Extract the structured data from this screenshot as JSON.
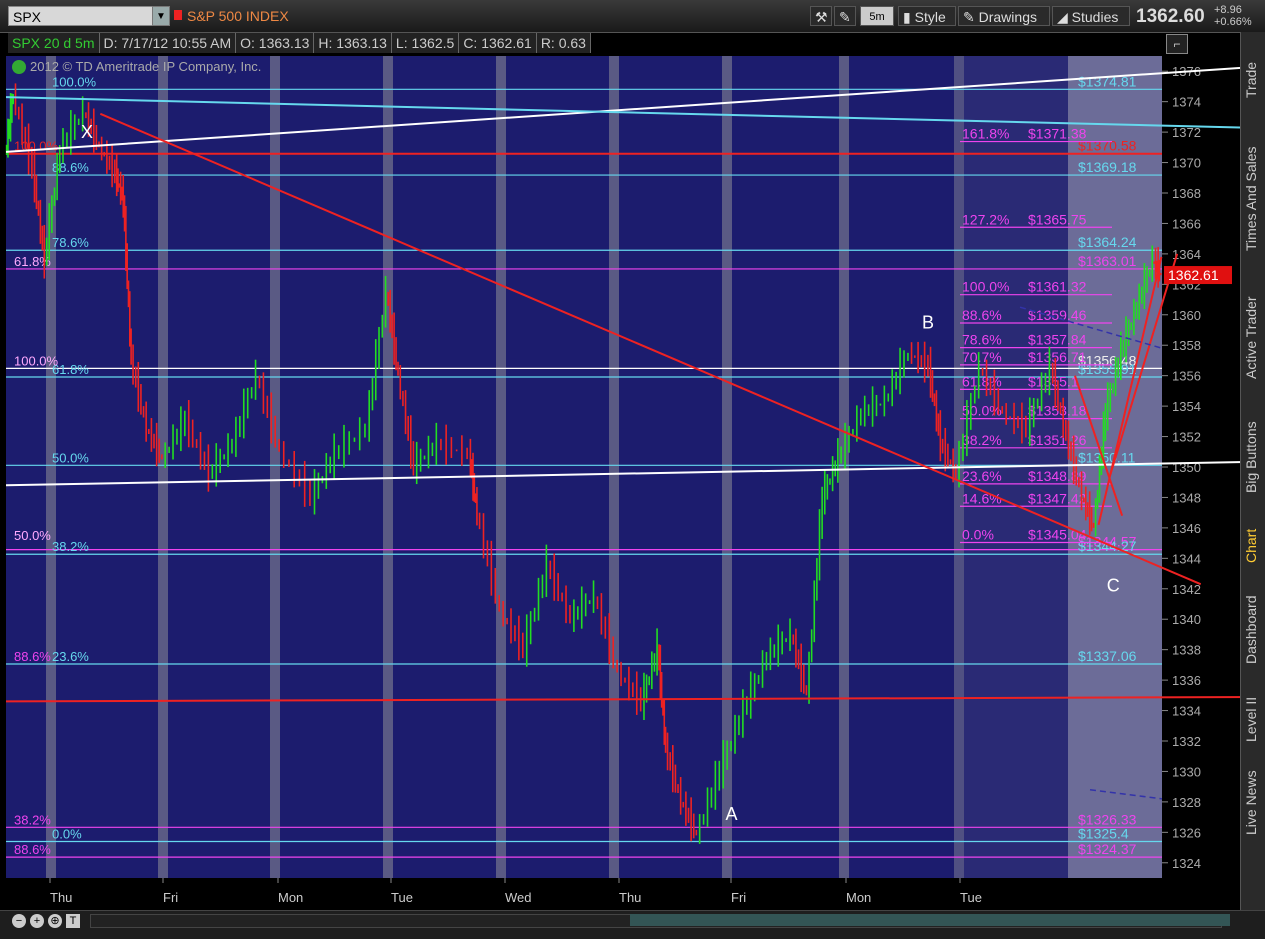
{
  "toolbar": {
    "symbol": "SPX",
    "symbol_name": "S&P 500 INDEX",
    "interval": "5m",
    "style_label": "Style",
    "drawings_label": "Drawings",
    "studies_label": "Studies",
    "last_price": "1362.60",
    "change": "+8.96",
    "change_pct": "+0.66%"
  },
  "info": {
    "symbol": "SPX 20 d 5m",
    "date": "D: 7/17/12 10:55 AM",
    "open": "O: 1363.13",
    "high": "H: 1363.13",
    "low": "L: 1362.5",
    "close": "C: 1362.61",
    "range": "R: 0.63"
  },
  "copyright": "2012 © TD Ameritrade IP Company, Inc.",
  "side_tabs": [
    "Trade",
    "Times And Sales",
    "Active Trader",
    "Big Buttons",
    "Chart",
    "Dashboard",
    "Level II",
    "Live News"
  ],
  "current_price_label": "1362.61",
  "colors": {
    "background": "#1c1c6e",
    "session_band": "#6a6a8a",
    "up": "#22dd22",
    "down": "#ee2222",
    "fib_cyan": "#66d8ee",
    "fib_magenta": "#ee44ee",
    "trend_red": "#ee2222",
    "trend_white": "#ffffff"
  },
  "chart_data": {
    "type": "line",
    "title": "",
    "xlabel": "",
    "ylabel": "",
    "x_ticks": [
      "Thu",
      "Fri",
      "Mon",
      "Tue",
      "Wed",
      "Thu",
      "Fri",
      "Mon",
      "Tue"
    ],
    "ylim": [
      1323,
      1377
    ],
    "y_ticks": [
      1324,
      1326,
      1328,
      1330,
      1332,
      1334,
      1336,
      1338,
      1340,
      1342,
      1344,
      1346,
      1348,
      1350,
      1352,
      1354,
      1356,
      1358,
      1360,
      1362,
      1364,
      1366,
      1368,
      1370,
      1372,
      1374,
      1376
    ],
    "price_path": [
      [
        0,
        1370.5
      ],
      [
        0.1,
        1374.5
      ],
      [
        0.35,
        1369.5
      ],
      [
        0.5,
        1363.5
      ],
      [
        0.7,
        1370.8
      ],
      [
        1.0,
        1373.3
      ],
      [
        1.2,
        1371.0
      ],
      [
        1.4,
        1369.2
      ],
      [
        1.5,
        1367.5
      ],
      [
        1.6,
        1357.0
      ],
      [
        1.8,
        1352.5
      ],
      [
        2.0,
        1350.5
      ],
      [
        2.3,
        1353.0
      ],
      [
        2.6,
        1349.5
      ],
      [
        2.9,
        1351.5
      ],
      [
        3.2,
        1356.0
      ],
      [
        3.5,
        1351.0
      ],
      [
        3.9,
        1348.0
      ],
      [
        4.2,
        1350.8
      ],
      [
        4.6,
        1352.5
      ],
      [
        4.85,
        1361.5
      ],
      [
        5.0,
        1356.0
      ],
      [
        5.2,
        1350.0
      ],
      [
        5.5,
        1351.5
      ],
      [
        5.9,
        1350.8
      ],
      [
        6.0,
        1347.0
      ],
      [
        6.3,
        1340.5
      ],
      [
        6.6,
        1338.0
      ],
      [
        6.9,
        1343.5
      ],
      [
        7.2,
        1340.0
      ],
      [
        7.5,
        1341.5
      ],
      [
        7.8,
        1336.5
      ],
      [
        8.1,
        1334.5
      ],
      [
        8.3,
        1338.0
      ],
      [
        8.4,
        1331.5
      ],
      [
        8.6,
        1328.0
      ],
      [
        8.8,
        1325.8
      ],
      [
        9.1,
        1330.0
      ],
      [
        9.4,
        1334.0
      ],
      [
        9.7,
        1337.5
      ],
      [
        10.0,
        1339.0
      ],
      [
        10.2,
        1335.0
      ],
      [
        10.4,
        1348.0
      ],
      [
        10.6,
        1350.5
      ],
      [
        10.9,
        1353.5
      ],
      [
        11.2,
        1354.3
      ],
      [
        11.5,
        1357.5
      ],
      [
        11.75,
        1356.5
      ],
      [
        11.9,
        1351.5
      ],
      [
        12.1,
        1349.5
      ],
      [
        12.4,
        1356.5
      ],
      [
        12.7,
        1353.5
      ],
      [
        13.0,
        1352.5
      ],
      [
        13.3,
        1356.5
      ],
      [
        13.5,
        1352.0
      ],
      [
        13.7,
        1348.0
      ],
      [
        13.85,
        1346.0
      ],
      [
        14.0,
        1353.5
      ],
      [
        14.2,
        1357.5
      ],
      [
        14.4,
        1360.5
      ],
      [
        14.6,
        1363.5
      ],
      [
        14.7,
        1362.6
      ]
    ],
    "trendlines": [
      {
        "color": "white",
        "points": [
          [
            0,
            1370.7
          ],
          [
            16.5,
            1376.5
          ]
        ]
      },
      {
        "color": "white",
        "points": [
          [
            0,
            1348.8
          ],
          [
            16.5,
            1350.4
          ]
        ]
      },
      {
        "color": "cyan",
        "points": [
          [
            0,
            1374.3
          ],
          [
            16.5,
            1372.2
          ]
        ]
      },
      {
        "color": "red",
        "points": [
          [
            1.2,
            1373.2
          ],
          [
            15.2,
            1342.3
          ]
        ]
      },
      {
        "color": "red",
        "points": [
          [
            0,
            1334.6
          ],
          [
            16.5,
            1334.9
          ]
        ]
      },
      {
        "color": "red",
        "points": [
          [
            13.6,
            1356.0
          ],
          [
            14.2,
            1346.8
          ]
        ]
      },
      {
        "color": "red",
        "points": [
          [
            13.9,
            1346.2
          ],
          [
            14.7,
            1363.8
          ]
        ]
      },
      {
        "color": "red",
        "points": [
          [
            14.05,
            1349.5
          ],
          [
            14.9,
            1364.0
          ]
        ]
      }
    ],
    "horizontal_levels": [
      {
        "value": 1374.81,
        "color": "cyan",
        "label": "$1374.81"
      },
      {
        "value": 1370.58,
        "color": "red",
        "label": "$1370.58"
      },
      {
        "value": 1369.18,
        "color": "cyan",
        "label": "$1369.18"
      },
      {
        "value": 1364.24,
        "color": "cyan",
        "label": "$1364.24"
      },
      {
        "value": 1363.01,
        "color": "magenta",
        "label": "$1363.01"
      },
      {
        "value": 1356.48,
        "color": "white",
        "label": "$1356.48"
      },
      {
        "value": 1355.91,
        "color": "cyan",
        "label": "$1355.91"
      },
      {
        "value": 1350.11,
        "color": "cyan",
        "label": "$1350.11"
      },
      {
        "value": 1344.57,
        "color": "magenta",
        "label": "$1344.57"
      },
      {
        "value": 1344.27,
        "color": "cyan",
        "label": "$1344.27"
      },
      {
        "value": 1337.06,
        "color": "cyan",
        "label": "$1337.06"
      },
      {
        "value": 1326.33,
        "color": "magenta",
        "label": "$1326.33"
      },
      {
        "value": 1325.4,
        "color": "cyan",
        "label": "$1325.4"
      },
      {
        "value": 1324.37,
        "color": "magenta",
        "label": "$1324.37"
      }
    ],
    "fib_right": [
      {
        "value": 1371.38,
        "pct": "161.8%",
        "label": "$1371.38"
      },
      {
        "value": 1365.75,
        "pct": "127.2%",
        "label": "$1365.75"
      },
      {
        "value": 1361.32,
        "pct": "100.0%",
        "label": "$1361.32"
      },
      {
        "value": 1359.46,
        "pct": "88.6%",
        "label": "$1359.46"
      },
      {
        "value": 1357.84,
        "pct": "78.6%",
        "label": "$1357.84"
      },
      {
        "value": 1356.71,
        "pct": "70.7%",
        "label": "$1356.71"
      },
      {
        "value": 1355.1,
        "pct": "61.8%",
        "label": "$1355.1"
      },
      {
        "value": 1353.18,
        "pct": "50.0%",
        "label": "$1353.18"
      },
      {
        "value": 1351.26,
        "pct": "38.2%",
        "label": "$1351.26"
      },
      {
        "value": 1348.89,
        "pct": "23.6%",
        "label": "$1348.89"
      },
      {
        "value": 1347.42,
        "pct": "14.6%",
        "label": "$1347.42"
      },
      {
        "value": 1345.04,
        "pct": "0.0%",
        "label": "$1345.04"
      }
    ],
    "fib_left_cyan": [
      {
        "value": 1374.81,
        "pct": "100.0%"
      },
      {
        "value": 1369.18,
        "pct": "88.6%"
      },
      {
        "value": 1364.24,
        "pct": "78.6%"
      },
      {
        "value": 1355.91,
        "pct": "61.8%"
      },
      {
        "value": 1350.11,
        "pct": "50.0%"
      },
      {
        "value": 1344.27,
        "pct": "38.2%"
      },
      {
        "value": 1337.06,
        "pct": "23.6%"
      },
      {
        "value": 1325.4,
        "pct": "0.0%"
      }
    ],
    "fib_left_magenta": [
      {
        "value": 1370.58,
        "pct": "100.0%"
      },
      {
        "value": 1363.01,
        "pct": "61.8%"
      },
      {
        "value": 1356.48,
        "pct": "100.0%"
      },
      {
        "value": 1345.0,
        "pct": "50.0%"
      },
      {
        "value": 1337.06,
        "pct": "88.6%"
      },
      {
        "value": 1326.33,
        "pct": "38.2%"
      },
      {
        "value": 1324.37,
        "pct": "88.6%"
      }
    ],
    "wave_labels": [
      {
        "text": "X",
        "x": 0.7,
        "y": 1372.0
      },
      {
        "text": "A",
        "x": 8.9,
        "y": 1327.2
      },
      {
        "text": "B",
        "x": 11.4,
        "y": 1359.5
      },
      {
        "text": "C",
        "x": 13.75,
        "y": 1342.2
      }
    ]
  }
}
